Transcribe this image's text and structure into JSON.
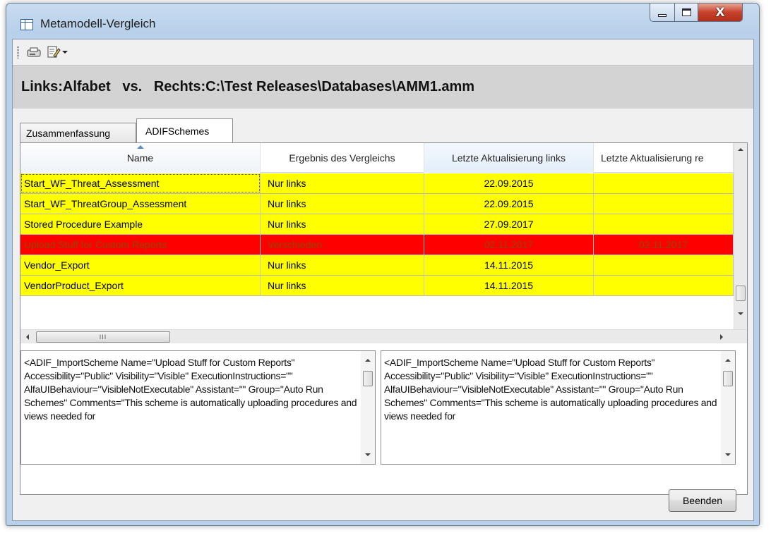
{
  "window": {
    "title": "Metamodell-Vergleich",
    "close_glyph": "X"
  },
  "toolbar": {
    "items": [
      "print-icon",
      "edit-icon"
    ]
  },
  "header": {
    "text": "Links:Alfabet   vs.   Rechts:C:\\Test Releases\\Databases\\AMM1.amm"
  },
  "tabs": [
    {
      "label": "Zusammenfassung",
      "active": false
    },
    {
      "label": "ADIFSchemes",
      "active": true
    }
  ],
  "grid": {
    "columns": [
      "Name",
      "Ergebnis des Vergleichs",
      "Letzte Aktualisierung links",
      "Letzte Aktualisierung re"
    ],
    "sorted_column": "Name",
    "rows": [
      {
        "name": "Start_WF_Threat_Assessment",
        "result": "Nur links",
        "left": "22.09.2015",
        "right": "",
        "status": "only-left"
      },
      {
        "name": "Start_WF_ThreatGroup_Assessment",
        "result": "Nur links",
        "left": "22.09.2015",
        "right": "",
        "status": "only-left"
      },
      {
        "name": "Stored Procedure Example",
        "result": "Nur links",
        "left": "27.09.2017",
        "right": "",
        "status": "only-left"
      },
      {
        "name": "Upload Stuff for Custom Reports",
        "result": "Verschieden",
        "left": "02.11.2017",
        "right": "02.11.2017",
        "status": "different"
      },
      {
        "name": "Vendor_Export",
        "result": "Nur links",
        "left": "14.11.2015",
        "right": "",
        "status": "only-left"
      },
      {
        "name": "VendorProduct_Export",
        "result": "Nur links",
        "left": "14.11.2015",
        "right": "",
        "status": "only-left"
      }
    ],
    "hscroll_thumb_label": "III"
  },
  "detail": {
    "left": "<ADIF_ImportScheme Name=\"Upload Stuff for Custom Reports\" Accessibility=\"Public\" Visibility=\"Visible\" ExecutionInstructions=\"\" AlfaUIBehaviour=\"VisibleNotExecutable\" Assistant=\"\" Group=\"Auto Run Schemes\" Comments=\"This scheme is automatically uploading procedures and views needed for",
    "right": "<ADIF_ImportScheme Name=\"Upload Stuff for Custom Reports\" Accessibility=\"Public\" Visibility=\"Visible\" ExecutionInstructions=\"\" AlfaUIBehaviour=\"VisibleNotExecutable\" Assistant=\"\" Group=\"Auto Run Schemes\" Comments=\"This scheme is automatically uploading procedures and views needed for"
  },
  "footer": {
    "close_button": "Beenden"
  },
  "colors": {
    "only_left": "#ffff00",
    "different": "#ff0000",
    "header_band": "#d3d3d3"
  }
}
